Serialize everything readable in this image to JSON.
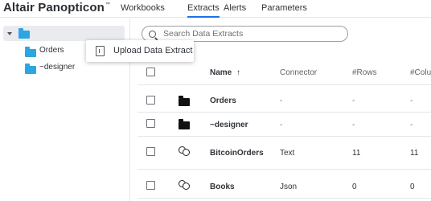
{
  "app": {
    "brand": "Altair Panopticon",
    "brand_mark": "™"
  },
  "nav": {
    "tabs": [
      "Workbooks",
      "Extracts",
      "Alerts",
      "Parameters"
    ],
    "active": "Extracts"
  },
  "tree": {
    "items": [
      "Orders",
      "~designer"
    ]
  },
  "context_menu": {
    "items": [
      "Upload Data Extract"
    ]
  },
  "search": {
    "placeholder": "Search Data Extracts"
  },
  "table": {
    "columns": [
      "Name",
      "Connector",
      "#Rows",
      "#Colu"
    ],
    "sort_indicator": "↑",
    "rows": [
      {
        "type": "folder",
        "name": "Orders",
        "connector": "-",
        "rows": "-",
        "cols": "-"
      },
      {
        "type": "folder",
        "name": "~designer",
        "connector": "-",
        "rows": "-",
        "cols": "-"
      },
      {
        "type": "extract",
        "name": "BitcoinOrders",
        "connector": "Text",
        "rows": "11",
        "cols": "11"
      },
      {
        "type": "extract",
        "name": "Books",
        "connector": "Json",
        "rows": "0",
        "cols": "0"
      }
    ]
  },
  "colors": {
    "accent": "#1a73e8",
    "folder_blue": "#2ba6e3",
    "folder_black": "#111111"
  }
}
